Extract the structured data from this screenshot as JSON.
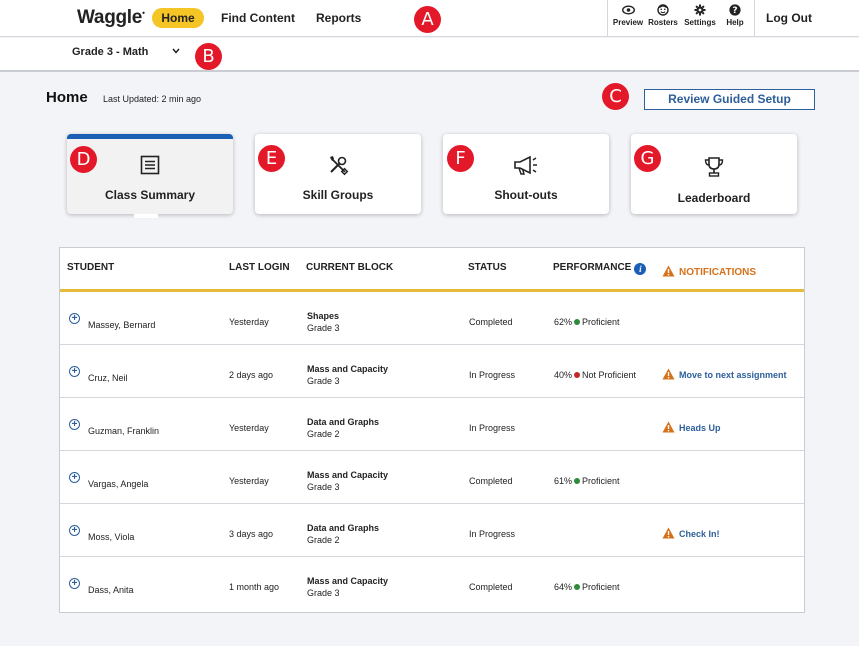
{
  "app": {
    "logo": "Waggle"
  },
  "nav": {
    "home": "Home",
    "find_content": "Find Content",
    "reports": "Reports",
    "tools": [
      {
        "label": "Preview",
        "icon": "eye-icon"
      },
      {
        "label": "Rosters",
        "icon": "face-icon"
      },
      {
        "label": "Settings",
        "icon": "gear-icon"
      },
      {
        "label": "Help",
        "icon": "help-icon"
      }
    ],
    "logout": "Log Out"
  },
  "markers": [
    "A",
    "B",
    "C",
    "D",
    "E",
    "F",
    "G"
  ],
  "grade": {
    "selected": "Grade 3 - Math"
  },
  "header": {
    "title": "Home",
    "last_updated": "Last Updated: 2 min ago",
    "review_button": "Review Guided Setup"
  },
  "cards": [
    {
      "label": "Class Summary",
      "icon": "list-icon",
      "active": true
    },
    {
      "label": "Skill Groups",
      "icon": "tools-icon"
    },
    {
      "label": "Shout-outs",
      "icon": "megaphone-icon"
    },
    {
      "label": "Leaderboard",
      "icon": "trophy-icon"
    }
  ],
  "table": {
    "columns": {
      "student": "STUDENT",
      "last_login": "LAST LOGIN",
      "current_block": "CURRENT BLOCK",
      "status": "STATUS",
      "performance": "PERFORMANCE",
      "notifications": "NOTIFICATIONS"
    },
    "rows": [
      {
        "student": "Massey, Bernard",
        "last_login": "Yesterday",
        "block": "Shapes",
        "grade": "Grade 3",
        "status": "Completed",
        "performance": "62%",
        "level": "Proficient",
        "level_color": "#2e8b3a",
        "notification": ""
      },
      {
        "student": "Cruz, Neil",
        "last_login": "2 days ago",
        "block": "Mass and Capacity",
        "grade": "Grade 3",
        "status": "In Progress",
        "performance": "40%",
        "level": "Not Proficient",
        "level_color": "#c62828",
        "notification": "Move to next assignment"
      },
      {
        "student": "Guzman, Franklin",
        "last_login": "Yesterday",
        "block": "Data and Graphs",
        "grade": "Grade 2",
        "status": "In Progress",
        "performance": "",
        "level": "",
        "level_color": "",
        "notification": "Heads Up"
      },
      {
        "student": "Vargas, Angela",
        "last_login": "Yesterday",
        "block": "Mass and Capacity",
        "grade": "Grade 3",
        "status": "Completed",
        "performance": "61%",
        "level": "Proficient",
        "level_color": "#2e8b3a",
        "notification": ""
      },
      {
        "student": "Moss, Viola",
        "last_login": "3 days ago",
        "block": "Data and Graphs",
        "grade": "Grade 2",
        "status": "In Progress",
        "performance": "",
        "level": "",
        "level_color": "",
        "notification": "Check In!"
      },
      {
        "student": "Dass, Anita",
        "last_login": "1 month ago",
        "block": "Mass and Capacity",
        "grade": "Grade 3",
        "status": "Completed",
        "performance": "64%",
        "level": "Proficient",
        "level_color": "#2e8b3a",
        "notification": ""
      }
    ]
  },
  "colors": {
    "accent_yellow": "#f5c425",
    "brand_blue": "#1a5fb4",
    "link_blue": "#2d5f9a",
    "warning_orange": "#d6711b",
    "marker_red": "#e3192a"
  }
}
